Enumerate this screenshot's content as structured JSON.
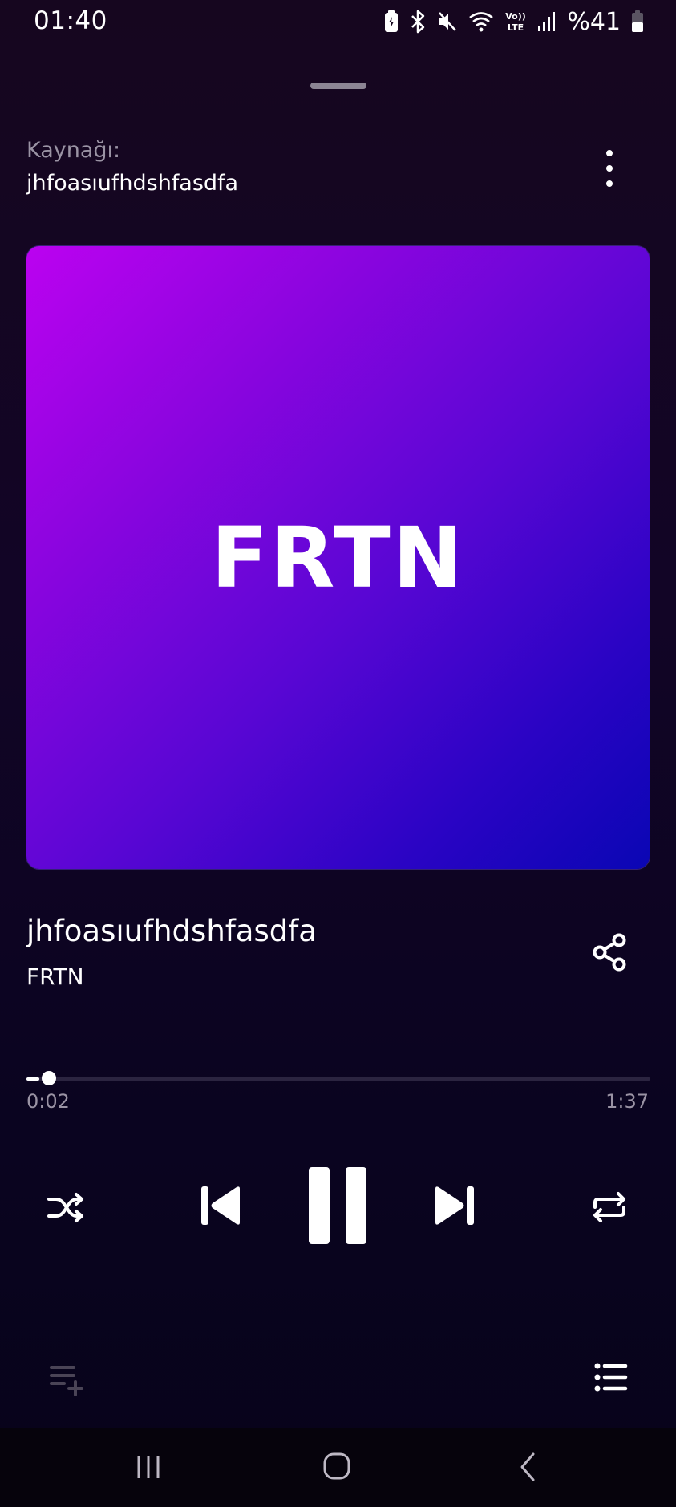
{
  "status_bar": {
    "time": "01:40",
    "battery": "%41",
    "icons": [
      "battery-saver-icon",
      "bluetooth-icon",
      "mute-icon",
      "wifi-icon",
      "volte-icon",
      "signal-icon",
      "battery-icon"
    ]
  },
  "source": {
    "label": "Kaynağı:",
    "name": "jhfoasıufhdshfasdfa"
  },
  "album_art": {
    "text": "FRTN",
    "gradient": [
      "#bb02f0",
      "#0a06b4"
    ]
  },
  "track": {
    "title": "jhfoasıufhdshfasdfa",
    "artist": "FRTN"
  },
  "progress": {
    "elapsed": "0:02",
    "total": "1:37",
    "fraction": 0.021
  },
  "controls": {
    "shuffle": "shuffle-icon",
    "previous": "skip-previous-icon",
    "play_pause": "pause-icon",
    "next": "skip-next-icon",
    "repeat": "repeat-icon"
  },
  "bottom_actions": {
    "add_to_queue": "playlist-add-icon",
    "queue": "queue-list-icon"
  },
  "navbar": {
    "recent": "recent-apps-icon",
    "home": "home-icon",
    "back": "back-icon"
  },
  "colors": {
    "background": "#120526",
    "text_muted": "#9a93a4",
    "accent": "#ffffff"
  }
}
